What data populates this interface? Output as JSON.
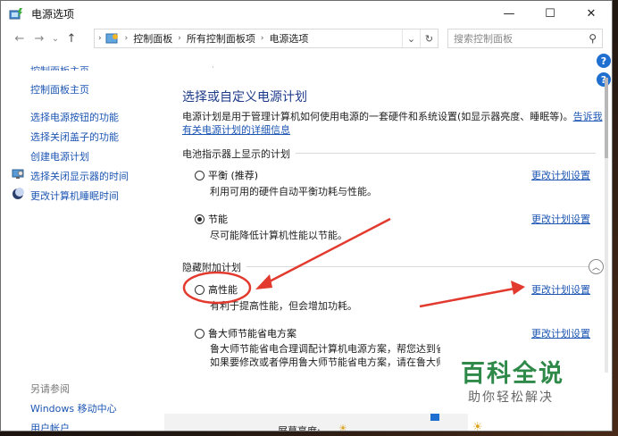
{
  "window": {
    "title": "电源选项",
    "controls": {
      "minimize": "—",
      "maximize": "☐",
      "close": "✕"
    }
  },
  "nav": {
    "back": "←",
    "forward": "→",
    "history": "⌄",
    "up": "↑",
    "refresh": "↻",
    "dropdown": "⌄"
  },
  "breadcrumb": [
    "控制面板",
    "所有控制面板项",
    "电源选项"
  ],
  "search": {
    "placeholder": "搜索控制面板",
    "icon": "search-icon"
  },
  "sidebar": {
    "cut_item": "控制面板主页",
    "home": "控制面板主页",
    "links": [
      {
        "label": "选择电源按钮的功能"
      },
      {
        "label": "选择关闭盖子的功能"
      },
      {
        "label": "创建电源计划"
      },
      {
        "label": "选择关闭显示器的时间",
        "icon": "display-icon"
      },
      {
        "label": "更改计算机睡眠时间",
        "icon": "moon-icon"
      }
    ],
    "see_also_title": "另请参阅",
    "see_also": [
      "Windows 移动中心",
      "用户帐户"
    ]
  },
  "main": {
    "heading": "选择或自定义电源计划",
    "intro_text": "电源计划是用于管理计算机如何使用电源的一套硬件和系统设置(如显示器亮度、睡眠等)。",
    "intro_link": "告诉我有关电源计划的详细信息",
    "battery_group_title": "电池指示器上显示的计划",
    "hidden_group_title": "隐藏附加计划",
    "change_link": "更改计划设置",
    "plans": [
      {
        "name": "平衡 (推荐)",
        "desc": "利用可用的硬件自动平衡功耗与性能。",
        "checked": false
      },
      {
        "name": "节能",
        "desc": "尽可能降低计算机性能以节能。",
        "checked": true
      },
      {
        "name": "高性能",
        "desc": "有利于提高性能，但会增加功耗。",
        "checked": false
      },
      {
        "name": "鲁大师节能省电方案",
        "desc": "鲁大师节能省电合理调配计算机电源方案，帮您达到省电",
        "desc2": "如果要修改或者停用鲁大师节能省电方案，请在鲁大师",
        "checked": false
      }
    ],
    "bottom_label": "屏幕亮度:"
  },
  "watermark": {
    "title": "百科全说",
    "subtitle": "助你轻松解决"
  },
  "colors": {
    "link": "#1d56b3",
    "heading": "#1e3a8a",
    "annotation_red": "#e23a2e",
    "brand_green": "#2f8a4a"
  }
}
